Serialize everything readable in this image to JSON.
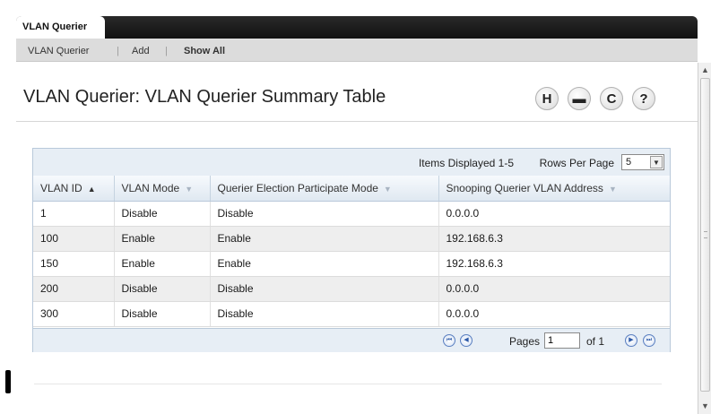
{
  "tabs": {
    "active": "VLAN Querier"
  },
  "subnav": {
    "items": [
      "VLAN Querier",
      "Add",
      "Show All"
    ],
    "separator": "|"
  },
  "page": {
    "title": "VLAN Querier: VLAN Querier Summary Table"
  },
  "toolbar": {
    "icons": [
      "save-icon",
      "print-icon",
      "refresh-icon",
      "help-icon"
    ],
    "glyphs": {
      "save": "H",
      "print": "▬",
      "refresh": "C",
      "help": "?"
    }
  },
  "table": {
    "items_displayed": "Items Displayed 1-5",
    "rows_per_page_label": "Rows Per Page",
    "rows_per_page_value": "5",
    "columns": [
      "VLAN ID",
      "VLAN Mode",
      "Querier Election Participate Mode",
      "Snooping Querier VLAN Address"
    ],
    "rows": [
      [
        "1",
        "Disable",
        "Disable",
        "0.0.0.0"
      ],
      [
        "100",
        "Enable",
        "Enable",
        "192.168.6.3"
      ],
      [
        "150",
        "Enable",
        "Enable",
        "192.168.6.3"
      ],
      [
        "200",
        "Disable",
        "Disable",
        "0.0.0.0"
      ],
      [
        "300",
        "Disable",
        "Disable",
        "0.0.0.0"
      ]
    ],
    "pager": {
      "pages_label": "Pages",
      "current_page": "1",
      "of_label": "of 1"
    }
  },
  "colors": {
    "header_bg": "#e7eef5",
    "accent": "#2c59a8",
    "topbar": "#111111"
  }
}
